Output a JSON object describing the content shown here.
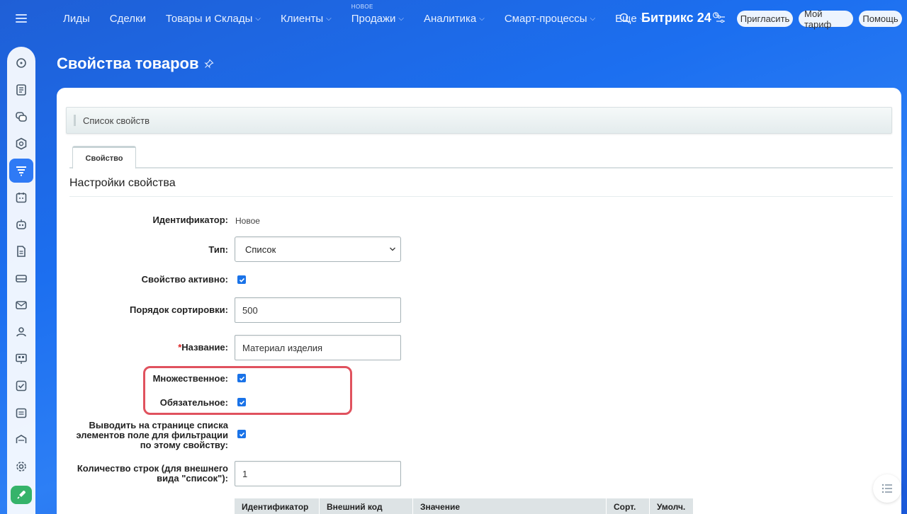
{
  "nav": {
    "items": [
      {
        "label": "Лиды",
        "dropdown": false
      },
      {
        "label": "Сделки",
        "dropdown": false
      },
      {
        "label": "Товары и Склады",
        "dropdown": true
      },
      {
        "label": "Клиенты",
        "dropdown": true
      },
      {
        "label": "Продажи",
        "dropdown": true,
        "badge": "НОВОЕ"
      },
      {
        "label": "Аналитика",
        "dropdown": true
      },
      {
        "label": "Смарт-процессы",
        "dropdown": true
      },
      {
        "label": "Еще",
        "dropdown": true
      }
    ],
    "brand": "Битрикс",
    "brand_suffix": "24",
    "buttons": {
      "invite": "Пригласить",
      "plan": "Мой тариф",
      "help": "Помощь"
    }
  },
  "page": {
    "title": "Свойства товаров"
  },
  "breadcrumb": "Список свойств",
  "tab_label": "Свойство",
  "section_title": "Настройки свойства",
  "form": {
    "id_label": "Идентификатор:",
    "id_value": "Новое",
    "type_label": "Тип:",
    "type_value": "Список",
    "active_label": "Свойство активно:",
    "active_checked": true,
    "sort_label": "Порядок сортировки:",
    "sort_value": "500",
    "name_required_mark": "*",
    "name_label": "Название:",
    "name_value": "Материал изделия",
    "multiple_label": "Множественное:",
    "multiple_checked": true,
    "required_label": "Обязательное:",
    "required_checked": true,
    "filter_label_1": "Выводить на странице списка",
    "filter_label_2": "элементов поле для фильтрации",
    "filter_label_3": "по этому свойству:",
    "filter_checked": true,
    "rows_label_1": "Количество строк (для внешнего",
    "rows_label_2": "вида \"список\"):",
    "rows_value": "1"
  },
  "table": {
    "headers": [
      "Идентификатор",
      "Внешний код",
      "Значение",
      "Сорт.",
      "Умолч."
    ]
  },
  "colors": {
    "accent": "#2f7af5",
    "highlight": "#e0525e",
    "checkbox": "#1a73e8"
  }
}
